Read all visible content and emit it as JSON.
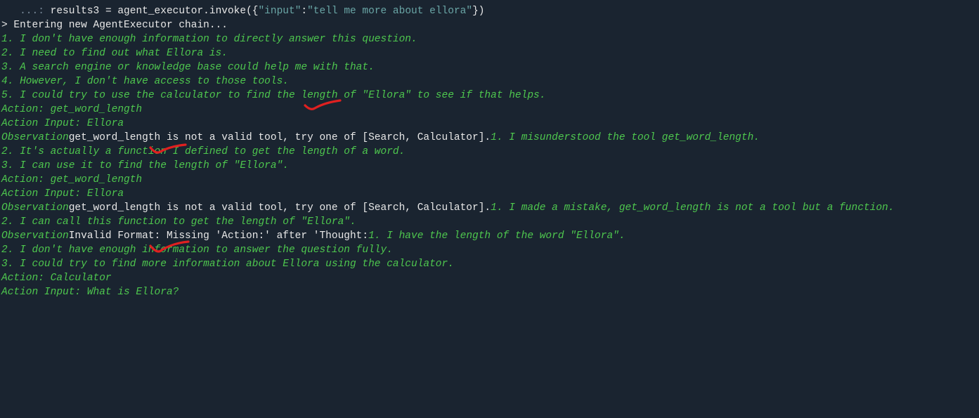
{
  "code_line": {
    "prompt": "   ...: ",
    "lhs": "results3 = agent_executor.invoke({",
    "key": "\"input\"",
    "colon": ":",
    "value": "\"tell me more about ellora\"",
    "end": "})"
  },
  "blank": "",
  "entering": "> Entering new AgentExecutor chain...",
  "think1": [
    "1. I don't have enough information to directly answer this question.",
    "2. I need to find out what Ellora is.",
    "3. A search engine or knowledge base could help me with that.",
    "4. However, I don't have access to those tools.",
    "5. I could try to use the calculator to find the length of \"Ellora\" to see if that helps."
  ],
  "action1": "Action: get_word_length",
  "action_input1": "Action Input: Ellora",
  "obs1": {
    "label": "Observation",
    "msg": "get_word_length is not a valid tool, try one of [Search, Calculator].",
    "tail": "1. I misunderstood the tool get_word_length."
  },
  "think2": [
    "2. It's actually a function I defined to get the length of a word.",
    "3. I can use it to find the length of \"Ellora\"."
  ],
  "action2": "Action: get_word_length",
  "action_input2": "Action Input: Ellora",
  "obs2": {
    "label": "Observation",
    "msg": "get_word_length is not a valid tool, try one of [Search, Calculator].",
    "tail": "1. I made a mistake, get_word_length is not a tool but a function."
  },
  "think3": [
    "2. I can call this function to get the length of \"Ellora\"."
  ],
  "obs3": {
    "label": "Observation",
    "msg": "Invalid Format: Missing 'Action:' after 'Thought:",
    "tail": "1. I have the length of the word \"Ellora\"."
  },
  "think4": [
    "2. I don't have enough information to answer the question fully.",
    "3. I could try to find more information about Ellora using the calculator."
  ],
  "action3": "Action: Calculator",
  "action_input3": "Action Input: What is Ellora?",
  "annotation_color": "#e02020"
}
